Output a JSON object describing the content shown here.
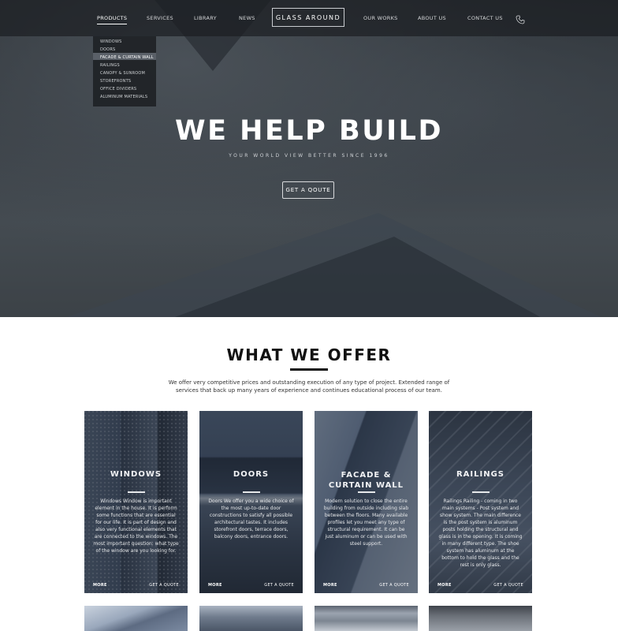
{
  "nav": {
    "items": [
      "PRODUCTS",
      "SERVICES",
      "LIBRARY",
      "NEWS",
      "OUR WORKS",
      "ABOUT US",
      "CONTACT US"
    ],
    "logo": "GLASS AROUND",
    "active": "PRODUCTS"
  },
  "dropdown": {
    "items": [
      "WINDOWS",
      "DOORS",
      "FACADE & CURTAIN WALL",
      "RAILINGS",
      "CANOPY & SUNROOM",
      "STOREFRONTS",
      "OFFICE DIVIDERS",
      "ALUMINUM MATERIALS"
    ],
    "highlighted": "FACADE & CURTAIN WALL"
  },
  "hero": {
    "title": "WE HELP BUILD",
    "subtitle": "YOUR WORLD VIEW BETTER SINCE 1996",
    "button": "GET A QOUTE"
  },
  "offer": {
    "title": "WHAT WE OFFER",
    "description": "We offer very competitive prices and outstanding execution of any type of project.  Extended range of services that back up many years of experience and  continues educational process of our team."
  },
  "cards": [
    {
      "title": "WINDOWS",
      "text": "Windows Window is important element in the house. It is perform some functions that are essential for our life. It is part of design and also very functional elements that are connected to the windows. The most important question: what type of the window are you looking for.",
      "more": "MORE",
      "quote": "GET A QUOTE"
    },
    {
      "title": "DOORS",
      "text": "Doors We offer you a wide choice of the most up-to-date door constructions to satisfy all possible architectural tastes. It includes storefront doors, terrace doors, balcony doors, entrance doors.",
      "more": "MORE",
      "quote": "GET A QUOTE"
    },
    {
      "title": "FACADE & CURTAIN WALL",
      "title_lines": [
        "FACADE &",
        "CURTAIN WALL"
      ],
      "text": "Modern solution to close the entire building from outside including slab between the floors. Many available profiles let you meet any type of structural requirement. It can be just aluminum or can be used with steel support.",
      "more": "MORE",
      "quote": "GET A QUOTE"
    },
    {
      "title": "RAILINGS",
      "text": "Railings Railing - coming in two main systems - Post system and show system. The main difference is the post system is aluminum posts holding the structural and glass is in the opening. It is coming in many different type. The shoe system has aluminum at the bottom to hold the glass and the rest is only glass.",
      "more": "MORE",
      "quote": "GET A QUOTE"
    }
  ]
}
